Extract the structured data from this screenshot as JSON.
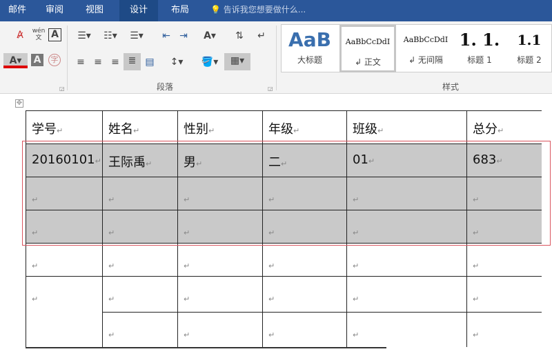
{
  "tabs": [
    "邮件",
    "审阅",
    "视图",
    "设计",
    "布局"
  ],
  "tell_me": "告诉我您想要做什么...",
  "groups": {
    "paragraph": "段落",
    "styles": "样式"
  },
  "styles": [
    {
      "preview": "AaB",
      "label": "大标题"
    },
    {
      "preview": "AaBbCcDdI",
      "label": "↲ 正文"
    },
    {
      "preview": "AaBbCcDdI",
      "label": "↲ 无间隔"
    },
    {
      "preview": "1. 1.",
      "label": "标题 1"
    },
    {
      "preview": "1.1",
      "label": "标题 2"
    }
  ],
  "table": {
    "headers": [
      "学号",
      "姓名",
      "性别",
      "年级",
      "班级",
      "总分"
    ],
    "row1": [
      "20160101",
      "王际禹",
      "男",
      "二",
      "01",
      "683"
    ],
    "para_mark": "↵",
    "move_handle": "✥"
  },
  "colors": {
    "tabbar": "#2b579a",
    "selection": "#c9c9c9",
    "redbox": "#d9535d"
  }
}
